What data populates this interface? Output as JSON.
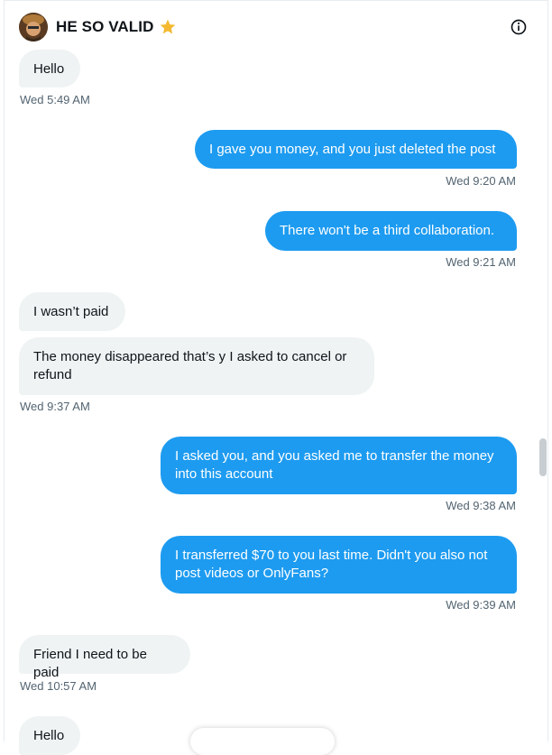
{
  "header": {
    "name": "HE SO VALID",
    "badge_icon": "star-icon",
    "info_icon": "info-icon"
  },
  "messages": [
    {
      "side": "in",
      "text": "Hello"
    },
    {
      "side": "in",
      "time": "Wed 5:49 AM"
    },
    {
      "side": "out",
      "text": "I gave you money, and you just deleted the post"
    },
    {
      "side": "out",
      "time": "Wed 9:20 AM"
    },
    {
      "side": "out",
      "text": "There won't be a third collaboration."
    },
    {
      "side": "out",
      "time": "Wed 9:21 AM"
    },
    {
      "side": "in",
      "text": "I wasn’t paid"
    },
    {
      "side": "in",
      "text": "The money disappeared that’s y I asked to cancel or refund"
    },
    {
      "side": "in",
      "time": "Wed 9:37 AM"
    },
    {
      "side": "out",
      "text": "I asked you, and you asked me to transfer the money into this account"
    },
    {
      "side": "out",
      "time": "Wed 9:38 AM"
    },
    {
      "side": "out",
      "text": "I transferred $70 to you last time. Didn't you also not post videos or OnlyFans?"
    },
    {
      "side": "out",
      "time": "Wed 9:39 AM"
    },
    {
      "side": "in",
      "text": "Friend I need to be paid"
    },
    {
      "side": "in",
      "time": "Wed 10:57 AM"
    },
    {
      "side": "in",
      "text": "Hello"
    }
  ],
  "colors": {
    "outgoing": "#1d9bf0",
    "incoming": "#eff3f4",
    "timestamp": "#536471"
  }
}
